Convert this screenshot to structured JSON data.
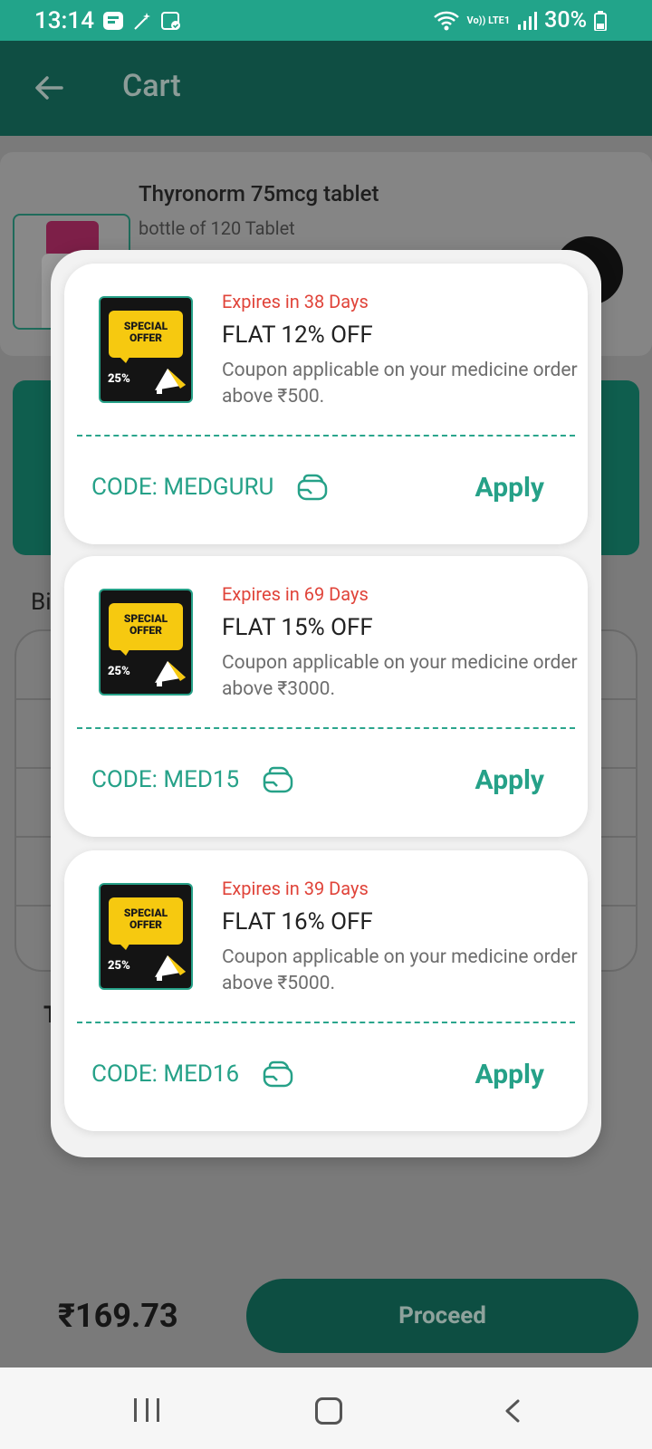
{
  "status_bar": {
    "time": "13:14",
    "network": "Vo)) LTE1",
    "battery": "30%"
  },
  "app_bar": {
    "title": "Cart"
  },
  "product": {
    "name": "Thyronorm 75mcg tablet",
    "pack": "bottle of 120  Tablet"
  },
  "bill": {
    "section_title": "Bi",
    "total_partial": "T"
  },
  "footer": {
    "price": "₹169.73",
    "proceed_label": "Proceed"
  },
  "coupons": [
    {
      "expires": "Expires in 38 Days",
      "title": "FLAT 12% OFF",
      "description": "Coupon applicable on your medicine order above ₹500.",
      "code": "CODE: MEDGURU",
      "apply_label": "Apply",
      "badge_text": "SPECIAL OFFER",
      "badge_pct": "25%"
    },
    {
      "expires": "Expires in 69 Days",
      "title": "FLAT 15% OFF",
      "description": "Coupon applicable on your medicine order above ₹3000.",
      "code": "CODE: MED15",
      "apply_label": "Apply",
      "badge_text": "SPECIAL OFFER",
      "badge_pct": "25%"
    },
    {
      "expires": "Expires in 39 Days",
      "title": "FLAT 16% OFF",
      "description": "Coupon applicable on your medicine order above ₹5000.",
      "code": "CODE: MED16",
      "apply_label": "Apply",
      "badge_text": "SPECIAL OFFER",
      "badge_pct": "25%"
    }
  ],
  "icons": {
    "back": "arrow-left-icon",
    "copy": "copy-icon",
    "trash": "trash-icon",
    "nav_recent": "recent-apps-icon",
    "nav_home": "home-icon",
    "nav_back": "back-chevron-icon"
  },
  "colors": {
    "accent": "#26a188",
    "expiry": "#e0443a",
    "app_bar": "#0f4e43"
  }
}
